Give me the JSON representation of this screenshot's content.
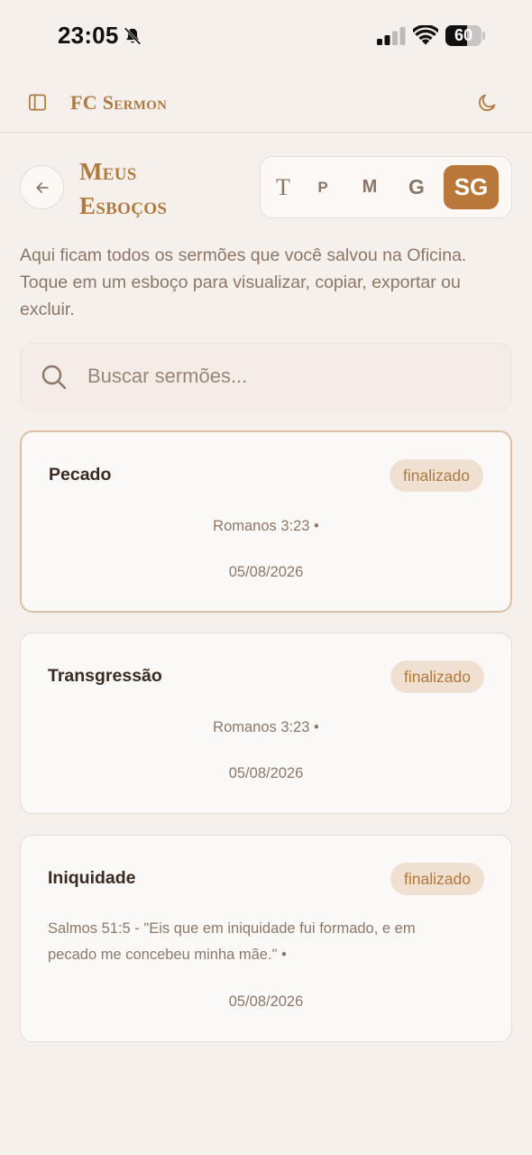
{
  "status": {
    "time": "23:05",
    "battery": "60"
  },
  "header": {
    "brand": "FC Sermon"
  },
  "page": {
    "title_line1": "Meus",
    "title_line2": "Esboços",
    "intro": "Aqui ficam todos os sermões que você salvou na Oficina. Toque em um esboço para visualizar, copiar, exportar ou excluir."
  },
  "font_sizes": {
    "options": [
      "T",
      "P",
      "M",
      "G",
      "SG"
    ],
    "selected": "SG"
  },
  "search": {
    "placeholder": "Buscar sermões..."
  },
  "sermons": [
    {
      "title": "Pecado",
      "status": "finalizado",
      "reference": "Romanos 3:23 •",
      "date": "05/08/2026"
    },
    {
      "title": "Transgressão",
      "status": "finalizado",
      "reference": "Romanos 3:23 •",
      "date": "05/08/2026"
    },
    {
      "title": "Iniquidade",
      "status": "finalizado",
      "reference": "Salmos 51:5 - \"Eis que em iniquidade fui formado, e em pecado me concebeu minha mãe.\" •",
      "date": "05/08/2026"
    }
  ],
  "colors": {
    "accent": "#b9783a",
    "background": "#f5f0ec",
    "badge_bg": "#efe0d2",
    "text_muted": "#8c7767"
  }
}
